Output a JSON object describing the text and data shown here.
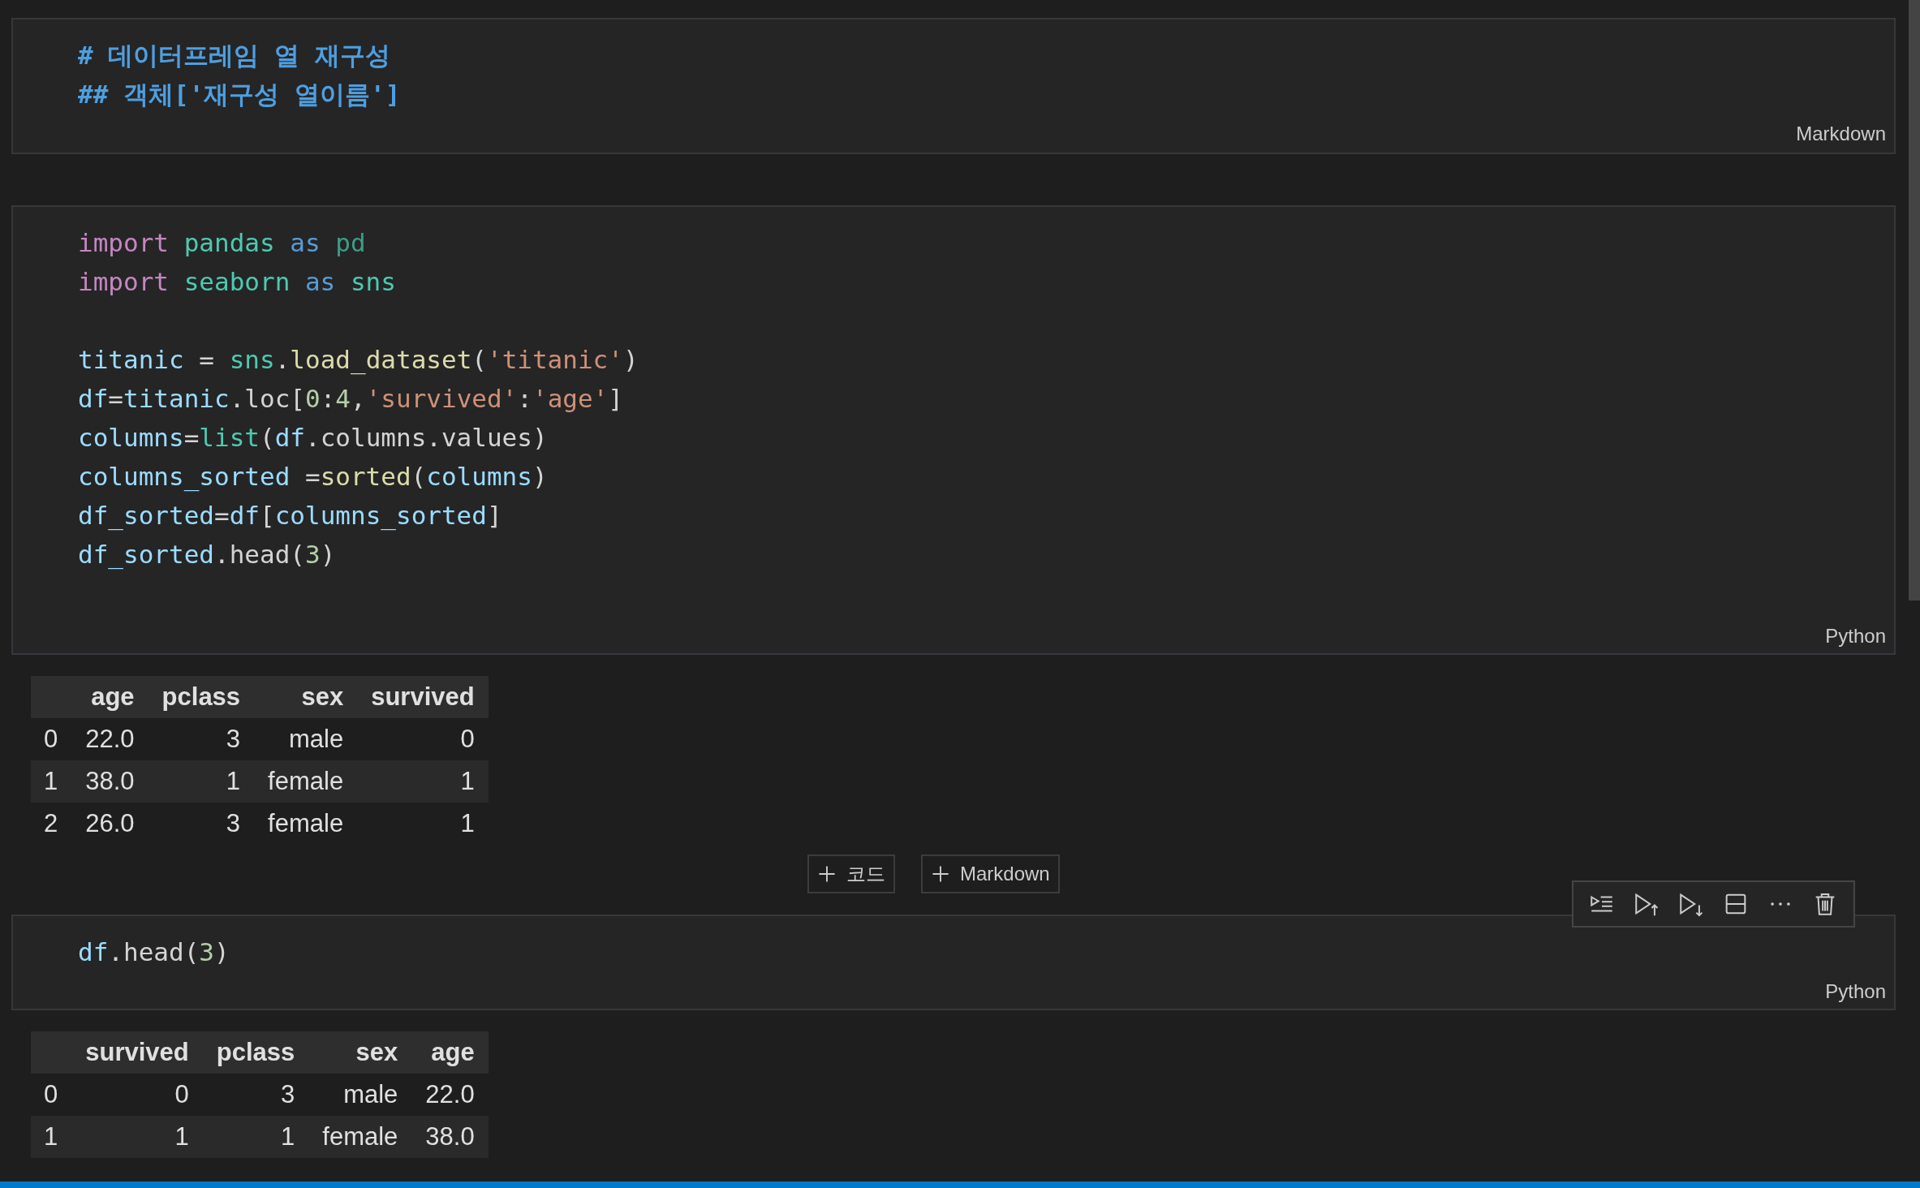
{
  "notebook": [
    {
      "kind": "markdown",
      "language": "Markdown",
      "lines": [
        "# 데이터프레임 열 재구성",
        "## 객체['재구성 열이름']"
      ]
    },
    {
      "kind": "code",
      "language": "Python",
      "focused": false,
      "code": [
        {
          "tokens": [
            {
              "text": "import",
              "kind": "keyword"
            },
            {
              "text": " pandas",
              "kind": "module"
            },
            {
              "text": " as",
              "kind": "storage"
            },
            {
              "text": " pd",
              "kind": "alias"
            }
          ]
        },
        {
          "tokens": [
            {
              "text": "import",
              "kind": "keyword"
            },
            {
              "text": " seaborn",
              "kind": "module"
            },
            {
              "text": " as",
              "kind": "storage"
            },
            {
              "text": " sns",
              "kind": "module"
            }
          ]
        },
        {
          "gap_before": true,
          "tokens": [
            {
              "text": "titanic",
              "kind": "variable"
            },
            {
              "text": " = ",
              "kind": "plain"
            },
            {
              "text": "sns",
              "kind": "module"
            },
            {
              "text": ".",
              "kind": "plain"
            },
            {
              "text": "load_dataset",
              "kind": "function"
            },
            {
              "text": "(",
              "kind": "plain"
            },
            {
              "text": "'titanic'",
              "kind": "string"
            },
            {
              "text": ")",
              "kind": "plain"
            }
          ]
        },
        {
          "tokens": [
            {
              "text": "df",
              "kind": "variable"
            },
            {
              "text": "=",
              "kind": "plain"
            },
            {
              "text": "titanic",
              "kind": "variable"
            },
            {
              "text": ".loc[",
              "kind": "plain"
            },
            {
              "text": "0",
              "kind": "number"
            },
            {
              "text": ":",
              "kind": "plain"
            },
            {
              "text": "4",
              "kind": "number"
            },
            {
              "text": ",",
              "kind": "plain"
            },
            {
              "text": "'survived'",
              "kind": "string"
            },
            {
              "text": ":",
              "kind": "plain"
            },
            {
              "text": "'age'",
              "kind": "string"
            },
            {
              "text": "]",
              "kind": "plain"
            }
          ]
        },
        {
          "tokens": [
            {
              "text": "columns",
              "kind": "variable"
            },
            {
              "text": "=",
              "kind": "plain"
            },
            {
              "text": "list",
              "kind": "module"
            },
            {
              "text": "(",
              "kind": "plain"
            },
            {
              "text": "df",
              "kind": "variable"
            },
            {
              "text": ".columns.values)",
              "kind": "plain"
            }
          ]
        },
        {
          "tokens": [
            {
              "text": "columns_sorted",
              "kind": "variable"
            },
            {
              "text": " =",
              "kind": "plain"
            },
            {
              "text": "sorted",
              "kind": "function"
            },
            {
              "text": "(",
              "kind": "plain"
            },
            {
              "text": "columns",
              "kind": "variable"
            },
            {
              "text": ")",
              "kind": "plain"
            }
          ]
        },
        {
          "tokens": [
            {
              "text": "df_sorted",
              "kind": "variable"
            },
            {
              "text": "=",
              "kind": "plain"
            },
            {
              "text": "df",
              "kind": "variable"
            },
            {
              "text": "[",
              "kind": "plain"
            },
            {
              "text": "columns_sorted",
              "kind": "variable"
            },
            {
              "text": "]",
              "kind": "plain"
            }
          ]
        },
        {
          "tokens": [
            {
              "text": "df_sorted",
              "kind": "variable"
            },
            {
              "text": ".head(",
              "kind": "plain"
            },
            {
              "text": "3",
              "kind": "number"
            },
            {
              "text": ")",
              "kind": "plain"
            }
          ]
        }
      ],
      "output": {
        "columns": [
          "",
          "age",
          "pclass",
          "sex",
          "survived"
        ],
        "rows": [
          [
            "0",
            "22.0",
            "3",
            "male",
            "0"
          ],
          [
            "1",
            "38.0",
            "1",
            "female",
            "1"
          ],
          [
            "2",
            "26.0",
            "3",
            "female",
            "1"
          ]
        ]
      }
    },
    {
      "kind": "insert",
      "buttons": [
        {
          "label": "코드"
        },
        {
          "label": "Markdown"
        }
      ]
    },
    {
      "kind": "code",
      "language": "Python",
      "focused": true,
      "code": [
        {
          "tokens": [
            {
              "text": "df",
              "kind": "variable"
            },
            {
              "text": ".head(",
              "kind": "plain"
            },
            {
              "text": "3",
              "kind": "number"
            },
            {
              "text": ")",
              "kind": "plain"
            }
          ]
        }
      ],
      "output": {
        "columns": [
          "",
          "survived",
          "pclass",
          "sex",
          "age"
        ],
        "rows": [
          [
            "0",
            "0",
            "3",
            "male",
            "22.0"
          ],
          [
            "1",
            "1",
            "1",
            "female",
            "38.0"
          ]
        ]
      }
    }
  ]
}
